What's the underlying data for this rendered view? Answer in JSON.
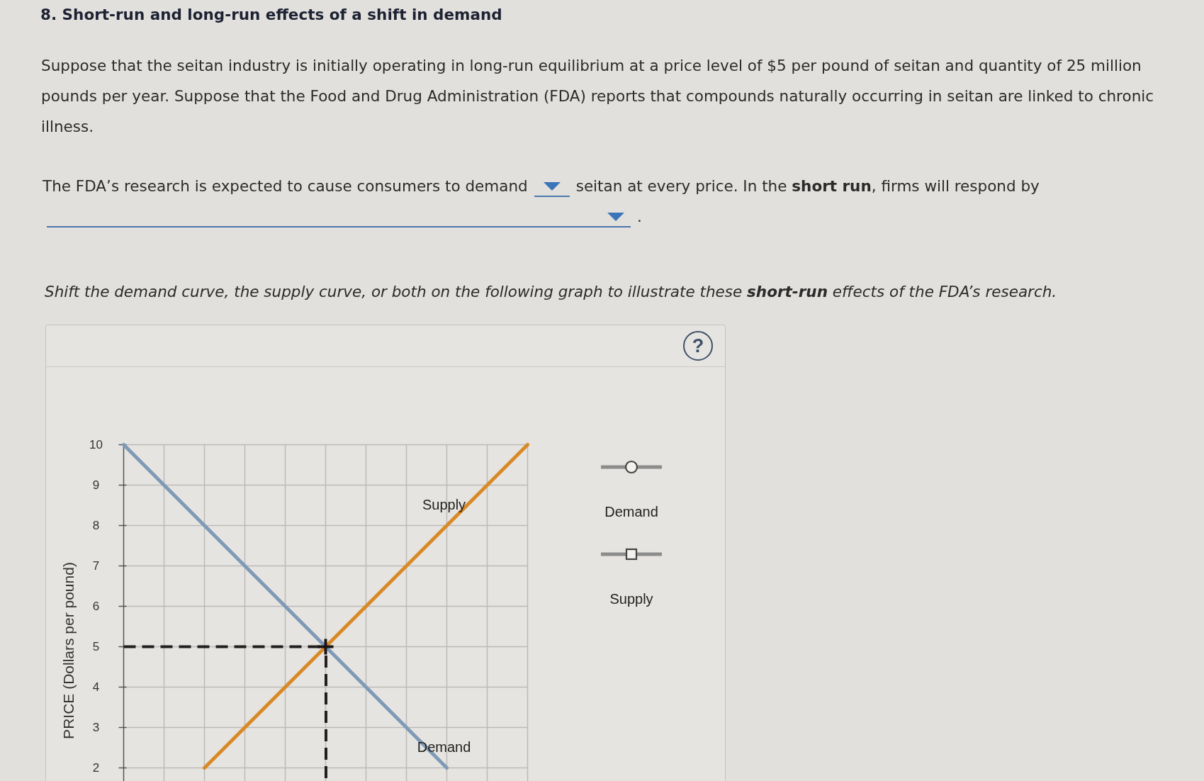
{
  "title": "8. Short-run and long-run effects of a shift in demand",
  "intro": "Suppose that the seitan industry is initially operating in long-run equilibrium at a price level of $5 per pound of seitan and quantity of 25 million pounds per year. Suppose that the Food and Drug Administration (FDA) reports that compounds naturally occurring in seitan are linked to chronic illness.",
  "question": [
    {
      "kind": "text",
      "text": "The FDA’s research is expected to cause consumers to demand"
    },
    {
      "kind": "short_select"
    },
    {
      "kind": "text",
      "text": "seitan at every price. In the **short run**, firms will respond by"
    },
    {
      "kind": "long_select"
    },
    {
      "kind": "text",
      "text": "."
    }
  ],
  "instruction": "Shift the demand curve, the supply curve, or both on the following graph to illustrate these **short-run** effects of the FDA’s research.",
  "graph": {
    "help_button": {
      "label": "?"
    },
    "chart_data": [
      {
        "type": "line",
        "ylabel": "PRICE (Dollars per pound)",
        "categories": [
          null,
          null,
          null,
          null,
          null,
          null,
          null,
          null,
          null,
          null,
          null
        ],
        "yticks": [
          2,
          3,
          4,
          5,
          6,
          7,
          8,
          9,
          10
        ],
        "ylim": [
          1.65,
          10
        ],
        "tick_labels": "y",
        "grid": true,
        "series": [
          {
            "name": "Demand",
            "color": "#7f9ab8",
            "values": [
              10,
              9,
              8,
              7,
              6,
              5,
              4,
              3,
              2,
              null,
              null
            ]
          },
          {
            "name": "Supply",
            "color": "#d98a26",
            "values": [
              null,
              null,
              2,
              3,
              4,
              5,
              6,
              7,
              8,
              9,
              10
            ]
          }
        ],
        "ref_lines": [
          {
            "axis": "y",
            "value": 5,
            "color": "#231f20",
            "line_style": "dashed"
          }
        ]
      }
    ],
    "tools": [
      {
        "kind": "circle",
        "label": "Demand"
      },
      {
        "kind": "square",
        "label": "Supply"
      }
    ]
  }
}
